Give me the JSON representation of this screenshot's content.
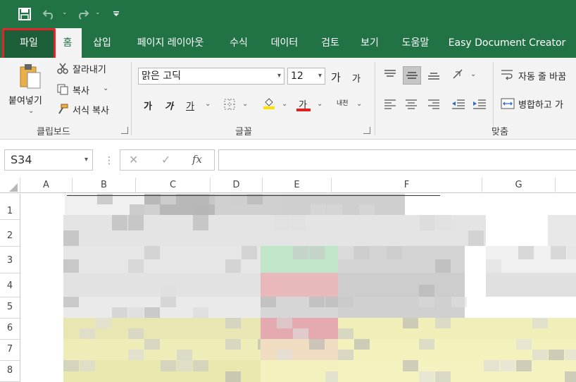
{
  "quick_access": {
    "save_icon": "save-icon",
    "undo_icon": "undo-icon",
    "redo_icon": "redo-icon",
    "customize_icon": "customize-qat-icon"
  },
  "tabs": [
    "파일",
    "홈",
    "삽입",
    "페이지 레이아웃",
    "수식",
    "데이터",
    "검토",
    "보기",
    "도움말",
    "Easy Document Creator"
  ],
  "ribbon": {
    "clipboard": {
      "paste_label": "붙여넣기",
      "cut_label": "잘라내기",
      "copy_label": "복사",
      "format_painter_label": "서식 복사",
      "group_label": "클립보드"
    },
    "font": {
      "font_name": "맑은 고딕",
      "font_size": "12",
      "grow_label": "가",
      "shrink_label": "가",
      "bold_label": "가",
      "italic_label": "가",
      "underline_label": "가",
      "font_color_label": "가",
      "phonetic_label": "내천",
      "group_label": "글꼴"
    },
    "alignment": {
      "wrap_text_label": "자동 줄 바꿈",
      "merge_label": "병합하고 가",
      "group_label": "맞춤"
    }
  },
  "formula_bar": {
    "name_box": "S34",
    "cancel": "✕",
    "enter": "✓",
    "fx": "fx"
  },
  "columns": [
    "A",
    "B",
    "C",
    "D",
    "E",
    "F",
    "G"
  ],
  "rows": [
    "1",
    "2",
    "3",
    "4",
    "5",
    "6",
    "7",
    "8"
  ],
  "colors": {
    "accent": "#217346",
    "highlight_border": "#e2252b",
    "fill_yellow": "#ffe100",
    "font_red": "#e0201c"
  }
}
